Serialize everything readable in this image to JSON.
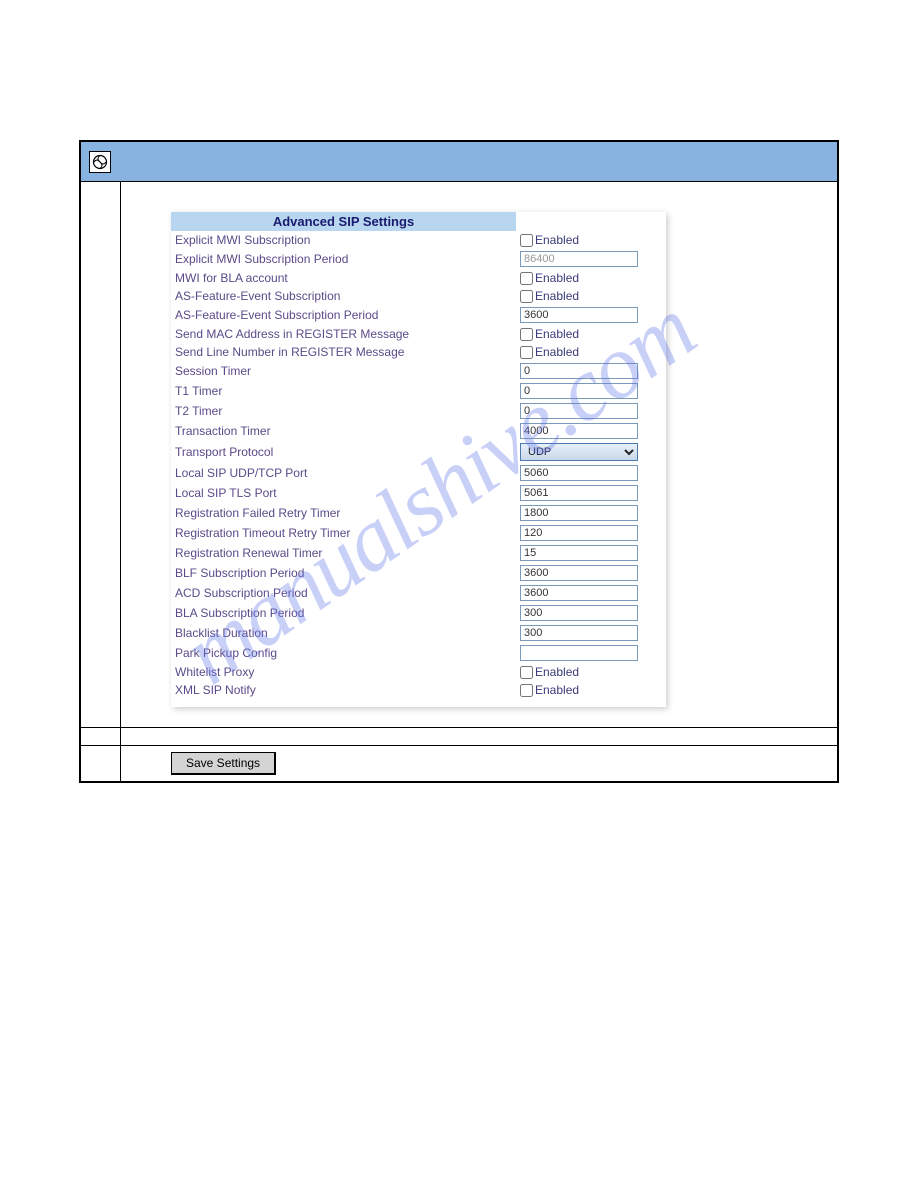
{
  "watermark": "manualshive.com",
  "section": {
    "title": "Advanced SIP Settings"
  },
  "settings": {
    "explicit_mwi_sub": {
      "label": "Explicit MWI Subscription",
      "enabled_text": "Enabled"
    },
    "explicit_mwi_period": {
      "label": "Explicit MWI Subscription Period",
      "value": "86400"
    },
    "mwi_bla": {
      "label": "MWI for BLA account",
      "enabled_text": "Enabled"
    },
    "as_feature_event": {
      "label": "AS-Feature-Event Subscription",
      "enabled_text": "Enabled"
    },
    "as_feature_period": {
      "label": "AS-Feature-Event Subscription Period",
      "value": "3600"
    },
    "send_mac": {
      "label": "Send MAC Address in REGISTER Message",
      "enabled_text": "Enabled"
    },
    "send_line": {
      "label": "Send Line Number in REGISTER Message",
      "enabled_text": "Enabled"
    },
    "session_timer": {
      "label": "Session Timer",
      "value": "0"
    },
    "t1_timer": {
      "label": "T1 Timer",
      "value": "0"
    },
    "t2_timer": {
      "label": "T2 Timer",
      "value": "0"
    },
    "transaction_timer": {
      "label": "Transaction Timer",
      "value": "4000"
    },
    "transport": {
      "label": "Transport Protocol",
      "value": "UDP"
    },
    "local_udp_port": {
      "label": "Local SIP UDP/TCP Port",
      "value": "5060"
    },
    "local_tls_port": {
      "label": "Local SIP TLS Port",
      "value": "5061"
    },
    "reg_failed_retry": {
      "label": "Registration Failed Retry Timer",
      "value": "1800"
    },
    "reg_timeout_retry": {
      "label": "Registration Timeout Retry Timer",
      "value": "120"
    },
    "reg_renewal": {
      "label": "Registration Renewal Timer",
      "value": "15"
    },
    "blf_period": {
      "label": "BLF Subscription Period",
      "value": "3600"
    },
    "acd_period": {
      "label": "ACD Subscription Period",
      "value": "3600"
    },
    "bla_period": {
      "label": "BLA Subscription Period",
      "value": "300"
    },
    "blacklist_duration": {
      "label": "Blacklist Duration",
      "value": "300"
    },
    "park_pickup": {
      "label": "Park Pickup Config",
      "value": ""
    },
    "whitelist_proxy": {
      "label": "Whitelist Proxy",
      "enabled_text": "Enabled"
    },
    "xml_sip_notify": {
      "label": "XML SIP Notify",
      "enabled_text": "Enabled"
    }
  },
  "buttons": {
    "save": "Save Settings"
  }
}
